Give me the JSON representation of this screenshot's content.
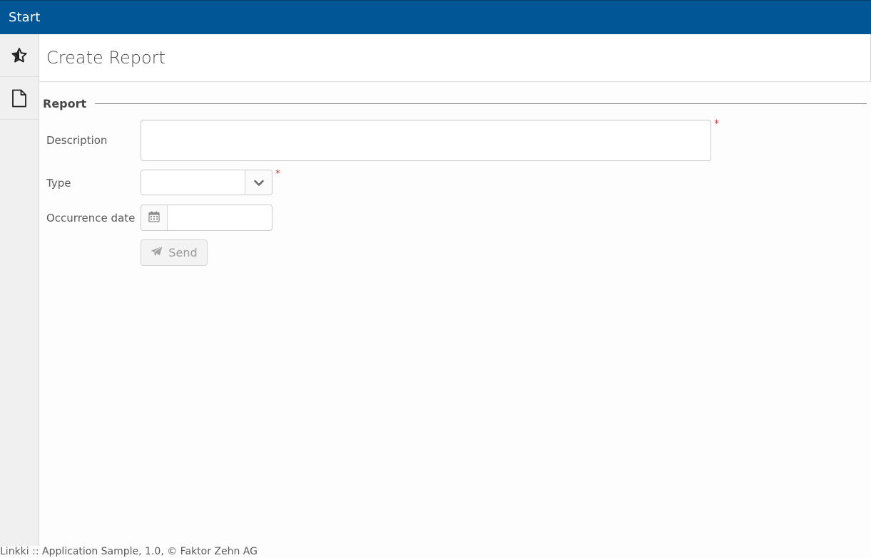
{
  "header": {
    "title": "Start"
  },
  "sidebar": {
    "items": [
      {
        "icon": "star-icon"
      },
      {
        "icon": "document-icon"
      }
    ]
  },
  "page": {
    "title": "Create Report"
  },
  "section": {
    "caption": "Report",
    "fields": {
      "description": {
        "label": "Description",
        "value": "",
        "required_mark": "*"
      },
      "type": {
        "label": "Type",
        "value": "",
        "required_mark": "*"
      },
      "occurrence_date": {
        "label": "Occurrence date",
        "value": ""
      }
    },
    "send_label": "Send"
  },
  "footer": {
    "text": "Linkki :: Application Sample, 1.0, © Faktor Zehn AG"
  },
  "colors": {
    "topbar": "#015696",
    "required": "#d6393b"
  }
}
